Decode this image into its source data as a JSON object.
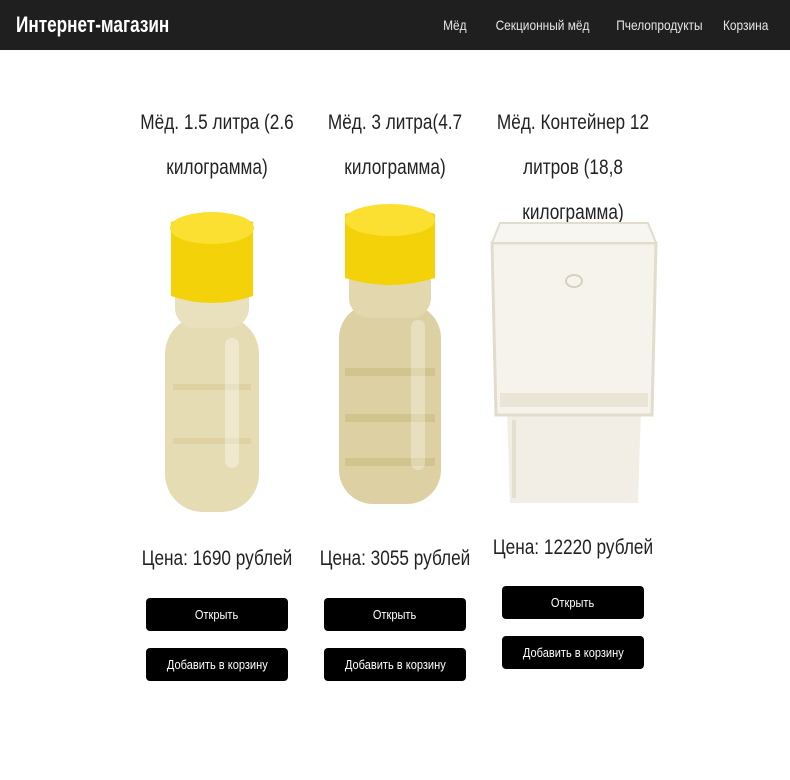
{
  "header": {
    "brand": "Интернет-магазин",
    "nav": [
      "Мёд",
      "Секционный мёд",
      "Пчелопродукты",
      "Корзина"
    ]
  },
  "products": [
    {
      "title": "Мёд. 1.5 литра (2.6 килограмма)",
      "price": "Цена: 1690 рублей",
      "open_label": "Открыть",
      "cart_label": "Добавить в корзину",
      "image": "honey-bottle-small"
    },
    {
      "title": "Мёд. 3 литра(4.7 килограмма)",
      "price": "Цена: 3055 рублей",
      "open_label": "Открыть",
      "cart_label": "Добавить в корзину",
      "image": "honey-bottle-large"
    },
    {
      "title": "Мёд. Контейнер 12 литров (18,8 килограмма)",
      "price": "Цена: 12220 рублей",
      "open_label": "Открыть",
      "cart_label": "Добавить в корзину",
      "image": "honey-container"
    }
  ],
  "colors": {
    "navbar": "#1f1f1f",
    "button": "#000000",
    "cap": "#f4d20a",
    "honey": "#e6dcb3",
    "container": "#f4f1ea"
  }
}
